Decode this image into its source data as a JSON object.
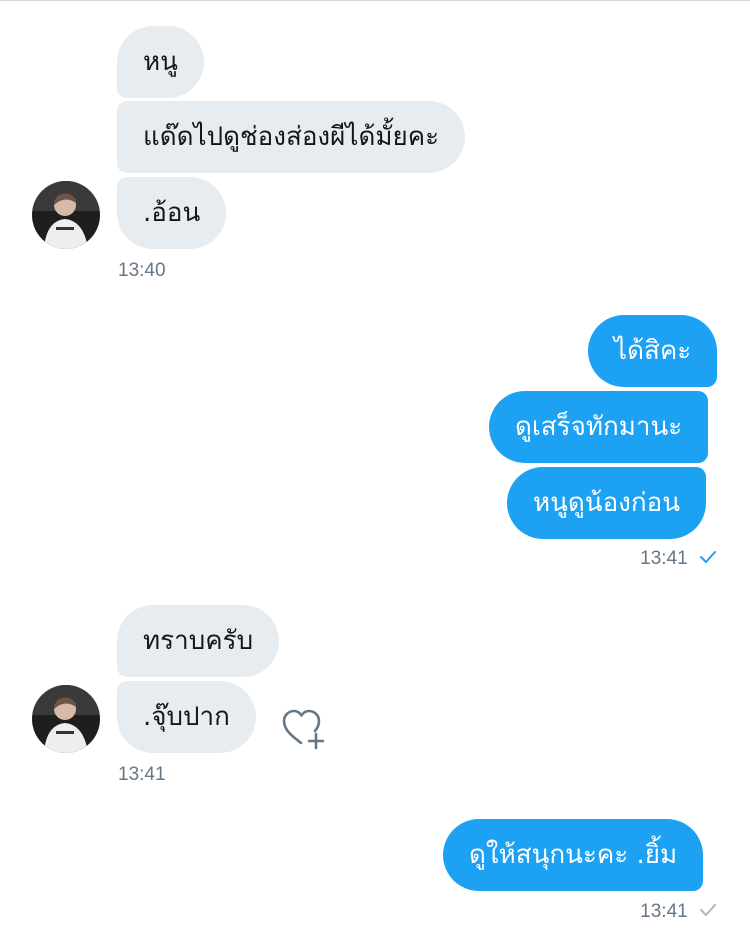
{
  "conversation": {
    "group1": {
      "messages": [
        "หนู",
        "แด๊ดไปดูช่องส่องผีได้มั้ยคะ",
        ".อ้อน"
      ],
      "time": "13:40"
    },
    "group2": {
      "messages": [
        "ได้สิคะ",
        "ดูเสร็จทักมานะ",
        "หนูดูน้องก่อน"
      ],
      "time": "13:41",
      "status": "seen"
    },
    "group3": {
      "messages": [
        "ทราบครับ",
        ".จุ๊บปาก"
      ],
      "time": "13:41"
    },
    "group4": {
      "messages": [
        "ดูให้สนุกนะคะ .ยิ้ม"
      ],
      "time": "13:41",
      "status": "sent"
    }
  },
  "icons": {
    "avatar": "user-avatar",
    "reaction": "heart-add-icon",
    "seen": "check-blue-icon",
    "sent": "check-gray-icon"
  },
  "colors": {
    "outgoing_bubble": "#1da1f2",
    "incoming_bubble": "#e6ecf0",
    "timestamp": "#657786"
  }
}
